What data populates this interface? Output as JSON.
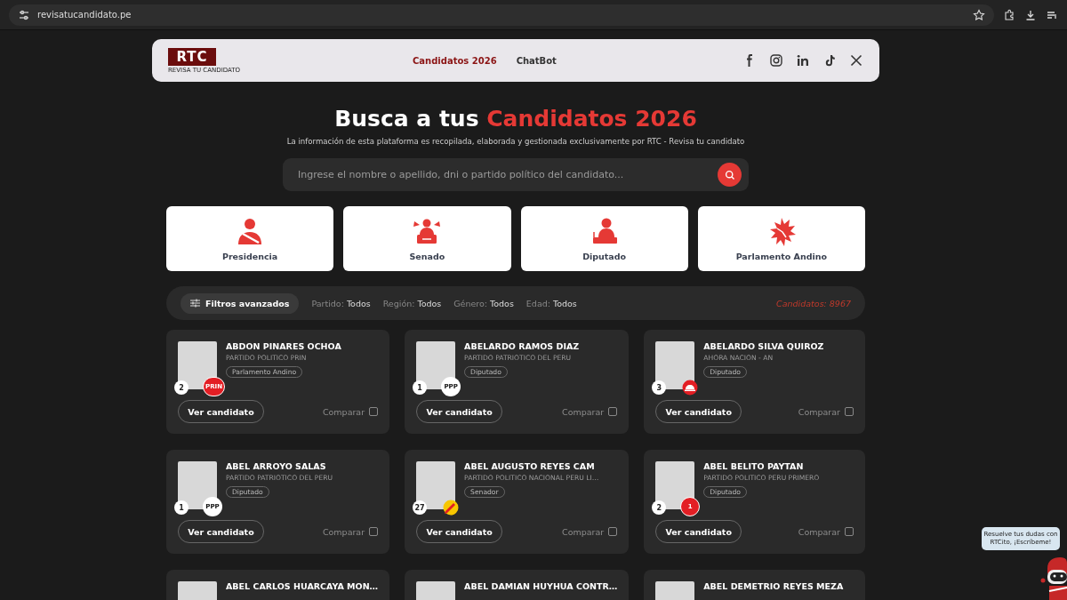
{
  "browser": {
    "url": "revisatucandidato.pe"
  },
  "nav": {
    "logo": {
      "title": "RTC",
      "subtitle": "REVISA TU CANDIDATO"
    },
    "links": [
      {
        "label": "Candidatos 2026",
        "selected": true
      },
      {
        "label": "ChatBot",
        "selected": false
      }
    ],
    "social": [
      {
        "kind": "facebook"
      },
      {
        "kind": "instagram"
      },
      {
        "kind": "linkedin"
      },
      {
        "kind": "tiktok"
      },
      {
        "kind": "x"
      }
    ]
  },
  "hero": {
    "title": "Busca a tus",
    "highlight": "Candidatos 2026",
    "subtitle": "La información de esta plataforma es recopilada, elaborada y gestionada exclusivamente por RTC - Revisa tu candidato"
  },
  "search": {
    "placeholder": "Ingrese el nombre o apellido, dni o partido político del candidato..."
  },
  "categories": [
    {
      "kind": "presidencia",
      "label": "Presidencia"
    },
    {
      "kind": "senado",
      "label": "Senado"
    },
    {
      "kind": "diputado",
      "label": "Diputado"
    },
    {
      "kind": "andino",
      "label": "Parlamento Andino"
    }
  ],
  "filters": {
    "button": "Filtros avanzados",
    "items": [
      {
        "label": "Partido:",
        "value": "Todos"
      },
      {
        "label": "Región:",
        "value": "Todos"
      },
      {
        "label": "Género:",
        "value": "Todos"
      },
      {
        "label": "Edad:",
        "value": "Todos"
      }
    ],
    "count": "Candidatos: 8967"
  },
  "candidates": [
    {
      "name": "ABDON PINARES OCHOA",
      "party": "PARTIDO POLITICO PRIN",
      "number": "2",
      "logo": {
        "kind": "red",
        "text": "PRIN"
      },
      "post": "Parlamento Andino",
      "button": "Ver candidato",
      "compare": "Comparar",
      "checked": false
    },
    {
      "name": "ABELARDO RAMOS DIAZ",
      "party": "PARTIDO PATRIOTICO DEL PERU",
      "number": "1",
      "logo": {
        "kind": "white",
        "text": "PPP"
      },
      "post": "Diputado",
      "button": "Ver candidato",
      "compare": "Comparar",
      "checked": false
    },
    {
      "name": "ABELARDO SILVA QUIROZ",
      "party": "AHORA NACION - AN",
      "number": "3",
      "logo": {
        "kind": "helmet"
      },
      "post": "Diputado",
      "button": "Ver candidato",
      "compare": "Comparar",
      "checked": false
    },
    {
      "name": "ABEL ARROYO SALAS",
      "party": "PARTIDO PATRIOTICO DEL PERU",
      "number": "1",
      "logo": {
        "kind": "white",
        "text": "PPP"
      },
      "post": "Diputado",
      "button": "Ver candidato",
      "compare": "Comparar",
      "checked": false
    },
    {
      "name": "ABEL AUGUSTO REYES CAM",
      "party": "PARTIDO POLITICO NACIONAL PERU LI…",
      "number": "27",
      "logo": {
        "kind": "pencil"
      },
      "post": "Senador",
      "button": "Ver candidato",
      "compare": "Comparar",
      "checked": false
    },
    {
      "name": "ABEL BELITO PAYTAN",
      "party": "PARTIDO POLITICO PERU PRIMERO",
      "number": "2",
      "logo": {
        "kind": "red",
        "text": "1"
      },
      "post": "Diputado",
      "button": "Ver candidato",
      "compare": "Comparar",
      "checked": false
    },
    {
      "name": "ABEL CARLOS HUARCAYA MON…"
    },
    {
      "name": "ABEL DAMIAN HUYHUA CONTR…"
    },
    {
      "name": "ABEL DEMETRIO REYES MEZA"
    }
  ],
  "chatbot": {
    "message": "Resuelve tus dudas con RTCito, ¡Escríbeme!"
  }
}
